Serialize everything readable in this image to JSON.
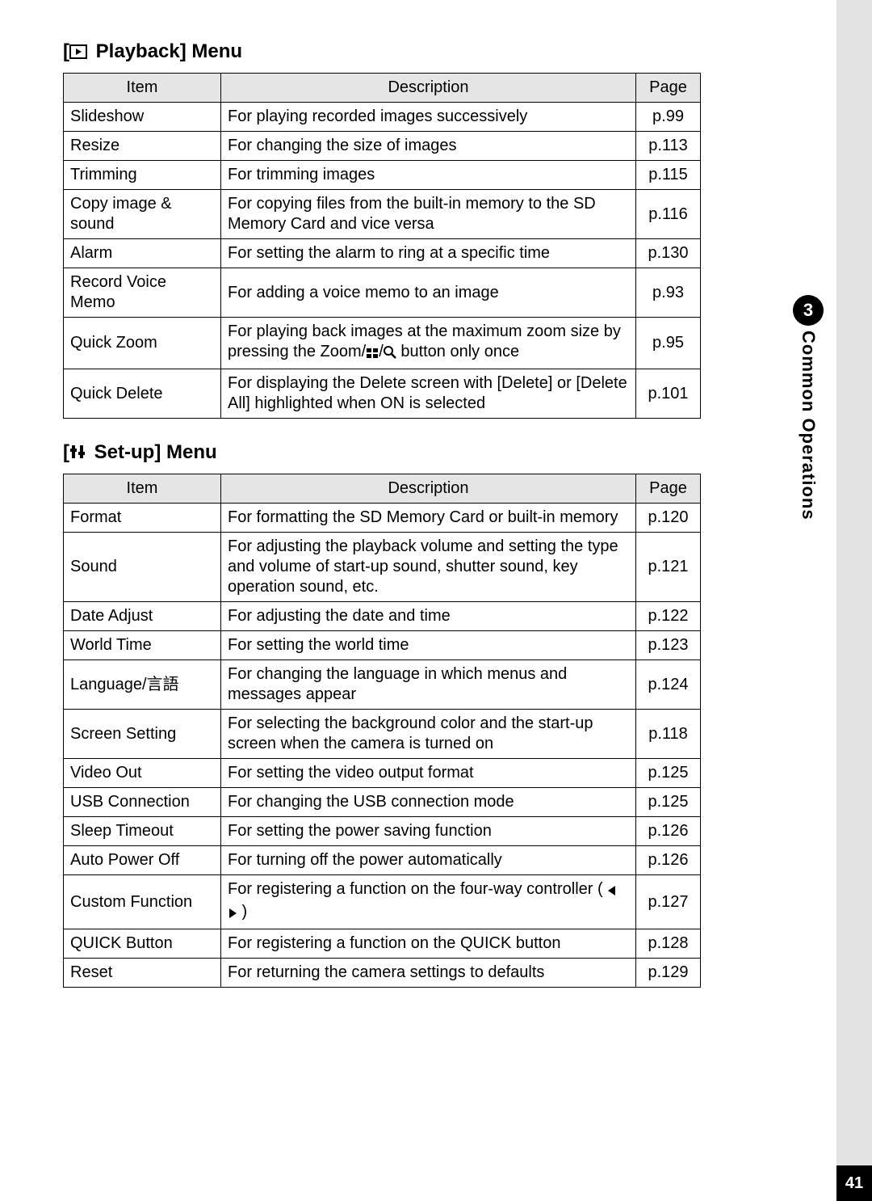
{
  "sidebar": {
    "section_number": "3",
    "section_title": "Common Operations",
    "page_number": "41"
  },
  "playback": {
    "heading_prefix": "[",
    "heading_suffix": " Playback] Menu",
    "headers": {
      "item": "Item",
      "description": "Description",
      "page": "Page"
    },
    "rows": [
      {
        "item": "Slideshow",
        "desc": "For playing recorded images successively",
        "page": "p.99"
      },
      {
        "item": "Resize",
        "desc": "For changing the size of images",
        "page": "p.113"
      },
      {
        "item": "Trimming",
        "desc": "For trimming images",
        "page": "p.115"
      },
      {
        "item": "Copy image & sound",
        "desc": "For copying files from the built-in memory to the SD Memory Card and vice versa",
        "page": "p.116"
      },
      {
        "item": "Alarm",
        "desc": "For setting the alarm to ring at a specific time",
        "page": "p.130"
      },
      {
        "item": "Record Voice Memo",
        "desc": "For adding a voice memo to an image",
        "page": "p.93"
      },
      {
        "item": "Quick Zoom",
        "desc_pre": "For playing back images at the maximum zoom size by pressing the Zoom/",
        "desc_post": " button only once",
        "page": "p.95",
        "has_icons": true
      },
      {
        "item": "Quick Delete",
        "desc": "For displaying the Delete screen with [Delete] or [Delete All] highlighted when ON is selected",
        "page": "p.101"
      }
    ]
  },
  "setup": {
    "heading_prefix": "[",
    "heading_suffix": " Set-up] Menu",
    "headers": {
      "item": "Item",
      "description": "Description",
      "page": "Page"
    },
    "rows": [
      {
        "item": "Format",
        "desc": "For formatting the SD Memory Card or built-in memory",
        "page": "p.120"
      },
      {
        "item": "Sound",
        "desc": "For adjusting the playback volume and setting the type and volume of start-up sound, shutter sound, key operation sound, etc.",
        "page": "p.121"
      },
      {
        "item": "Date Adjust",
        "desc": "For adjusting the date and time",
        "page": "p.122"
      },
      {
        "item": "World Time",
        "desc": "For setting the world time",
        "page": "p.123"
      },
      {
        "item": "Language/言語",
        "desc": "For changing the language in which menus and messages appear",
        "page": "p.124"
      },
      {
        "item": "Screen Setting",
        "desc": "For selecting the background color and the start-up screen when the camera is turned on",
        "page": "p.118"
      },
      {
        "item": "Video Out",
        "desc": "For setting the video output format",
        "page": "p.125"
      },
      {
        "item": "USB Connection",
        "desc": "For changing the USB connection mode",
        "page": "p.125"
      },
      {
        "item": "Sleep Timeout",
        "desc": "For setting the power saving function",
        "page": "p.126"
      },
      {
        "item": "Auto Power Off",
        "desc": "For turning off the power automatically",
        "page": "p.126"
      },
      {
        "item": "Custom Function",
        "desc_pre": "For registering a function on the four-way controller ( ",
        "desc_post": " )",
        "has_arrows": true,
        "page": "p.127"
      },
      {
        "item": "QUICK Button",
        "desc": "For registering a function on the QUICK button",
        "page": "p.128"
      },
      {
        "item": "Reset",
        "desc": "For returning the camera settings to defaults",
        "page": "p.129"
      }
    ]
  }
}
